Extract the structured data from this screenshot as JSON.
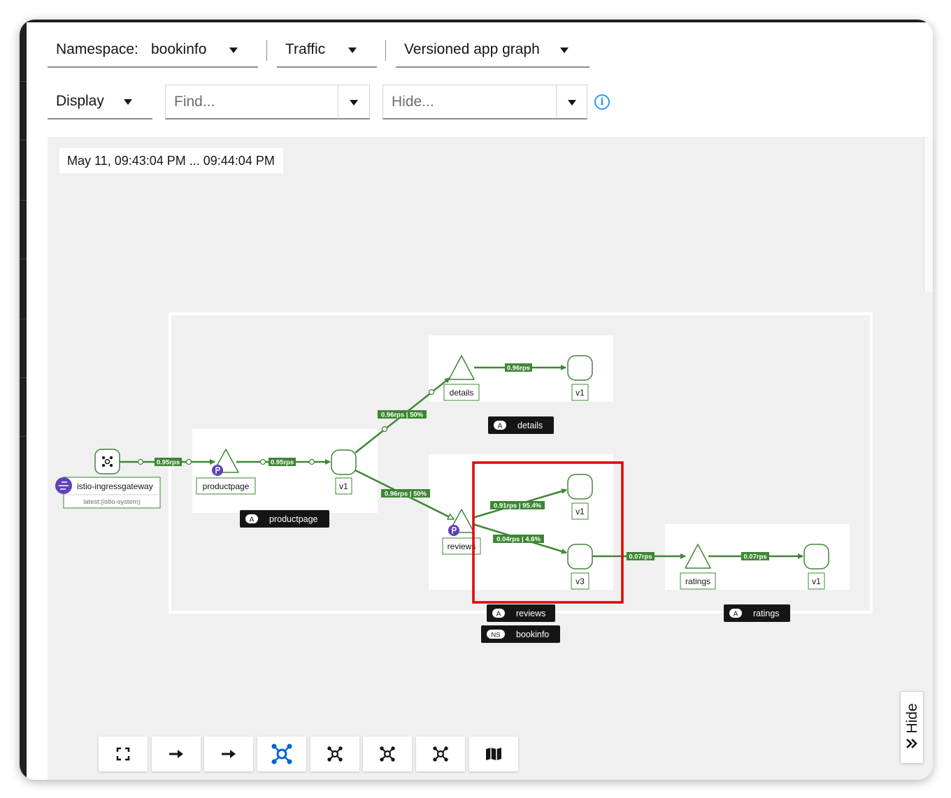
{
  "toolbar": {
    "namespace_label": "Namespace:",
    "namespace_value": "bookinfo",
    "traffic_label": "Traffic",
    "graph_type_label": "Versioned app graph",
    "display_label": "Display",
    "find_placeholder": "Find...",
    "hide_placeholder": "Hide...",
    "info_icon": "info-circle-icon"
  },
  "graph": {
    "time_range": "May 11, 09:43:04 PM ... 09:44:04 PM",
    "gateway": {
      "name": "istio-ingressgateway",
      "sublabel": "latest:(istio-system)"
    },
    "nodes": {
      "productpage_service": "productpage",
      "productpage_v1": "v1",
      "details_service": "details",
      "details_v1": "v1",
      "reviews_service": "reviews",
      "reviews_v1": "v1",
      "reviews_v3": "v3",
      "ratings_service": "ratings",
      "ratings_v1": "v1"
    },
    "edges": {
      "gw_to_productpage": "0.95rps",
      "productpage_to_v1": "0.95rps",
      "v1_to_details": "0.96rps | 50%",
      "details_to_v1": "0.96rps",
      "v1_to_reviews": "0.96rps | 50%",
      "reviews_to_v1": "0.91rps | 95.4%",
      "reviews_to_v3": "0.04rps | 4.6%",
      "v3_to_ratings": "0.07rps",
      "ratings_to_v1": "0.07rps"
    },
    "boxes": {
      "app_badge": "A",
      "ns_badge": "NS",
      "details": "details",
      "productpage": "productpage",
      "reviews": "reviews",
      "ratings": "ratings",
      "namespace": "bookinfo"
    },
    "colors": {
      "edge": "#3e8635",
      "highlight": "#e00000",
      "label_bg": "#151515"
    }
  },
  "bottom_toolbar": {
    "buttons": [
      "expand-icon",
      "arrow-right-icon",
      "arrow-right-icon",
      "topology-icon",
      "topology-icon",
      "topology-icon",
      "topology-icon",
      "map-icon"
    ]
  },
  "side_panel": {
    "hide_label": "Hide"
  }
}
